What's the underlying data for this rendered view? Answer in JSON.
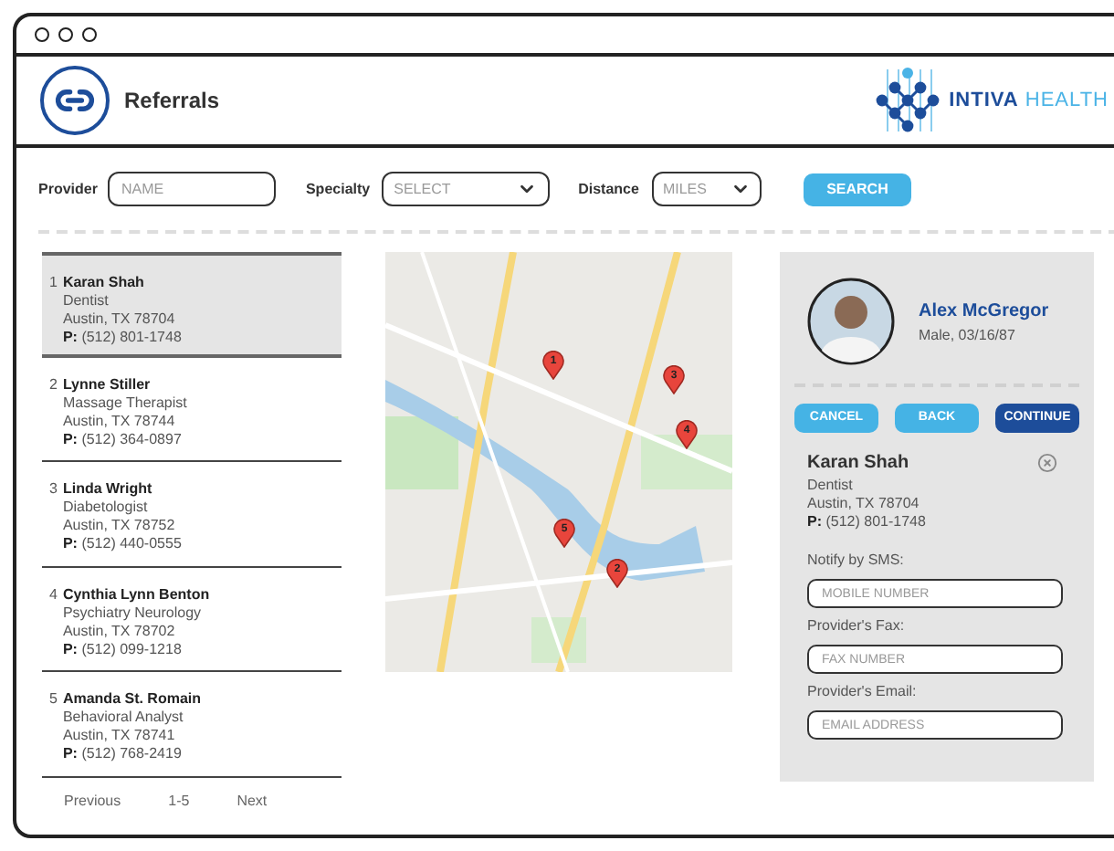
{
  "header": {
    "title": "Referrals",
    "logo": {
      "brand": "INTIVA",
      "suffix": "HEALTH"
    }
  },
  "filters": {
    "provider": {
      "label": "Provider",
      "placeholder": "NAME"
    },
    "specialty": {
      "label": "Specialty",
      "placeholder": "SELECT"
    },
    "distance": {
      "label": "Distance",
      "placeholder": "MILES"
    },
    "search_button": "SEARCH"
  },
  "results": [
    {
      "index": "1",
      "name": "Karan Shah",
      "specialty": "Dentist",
      "address": "Austin, TX 78704",
      "phone_label": "P:",
      "phone": "(512) 801-1748",
      "selected": true
    },
    {
      "index": "2",
      "name": "Lynne Stiller",
      "specialty": "Massage Therapist",
      "address": "Austin, TX 78744",
      "phone_label": "P:",
      "phone": "(512) 364-0897",
      "selected": false
    },
    {
      "index": "3",
      "name": "Linda Wright",
      "specialty": "Diabetologist",
      "address": "Austin, TX 78752",
      "phone_label": "P:",
      "phone": "(512) 440-0555",
      "selected": false
    },
    {
      "index": "4",
      "name": "Cynthia Lynn Benton",
      "specialty": "Psychiatry Neurology",
      "address": "Austin, TX 78702",
      "phone_label": "P:",
      "phone": "(512) 099-1218",
      "selected": false
    },
    {
      "index": "5",
      "name": "Amanda St. Romain",
      "specialty": "Behavioral Analyst",
      "address": "Austin, TX 78741",
      "phone_label": "P:",
      "phone": "(512) 768-2419",
      "selected": false
    }
  ],
  "pagination": {
    "previous": "Previous",
    "range": "1-5",
    "next": "Next"
  },
  "map": {
    "kind": "picture",
    "pins": [
      {
        "label": "1"
      },
      {
        "label": "2"
      },
      {
        "label": "3"
      },
      {
        "label": "4"
      },
      {
        "label": "5"
      }
    ]
  },
  "patient": {
    "name": "Alex McGregor",
    "details": "Male, 03/16/87"
  },
  "actions": [
    {
      "label": "CANCEL",
      "kind": "secondary"
    },
    {
      "label": "BACK",
      "kind": "secondary"
    },
    {
      "label": "CONTINUE",
      "kind": "primary"
    }
  ],
  "referral": {
    "name": "Karan Shah",
    "specialty": "Dentist",
    "address": "Austin, TX 78704",
    "phone_label": "P:",
    "phone": "(512) 801-1748",
    "fields": [
      {
        "label": "Notify by SMS:",
        "placeholder": "MOBILE NUMBER"
      },
      {
        "label": "Provider's Fax:",
        "placeholder": "FAX NUMBER"
      },
      {
        "label": "Provider's Email:",
        "placeholder": "EMAIL ADDRESS"
      }
    ]
  }
}
